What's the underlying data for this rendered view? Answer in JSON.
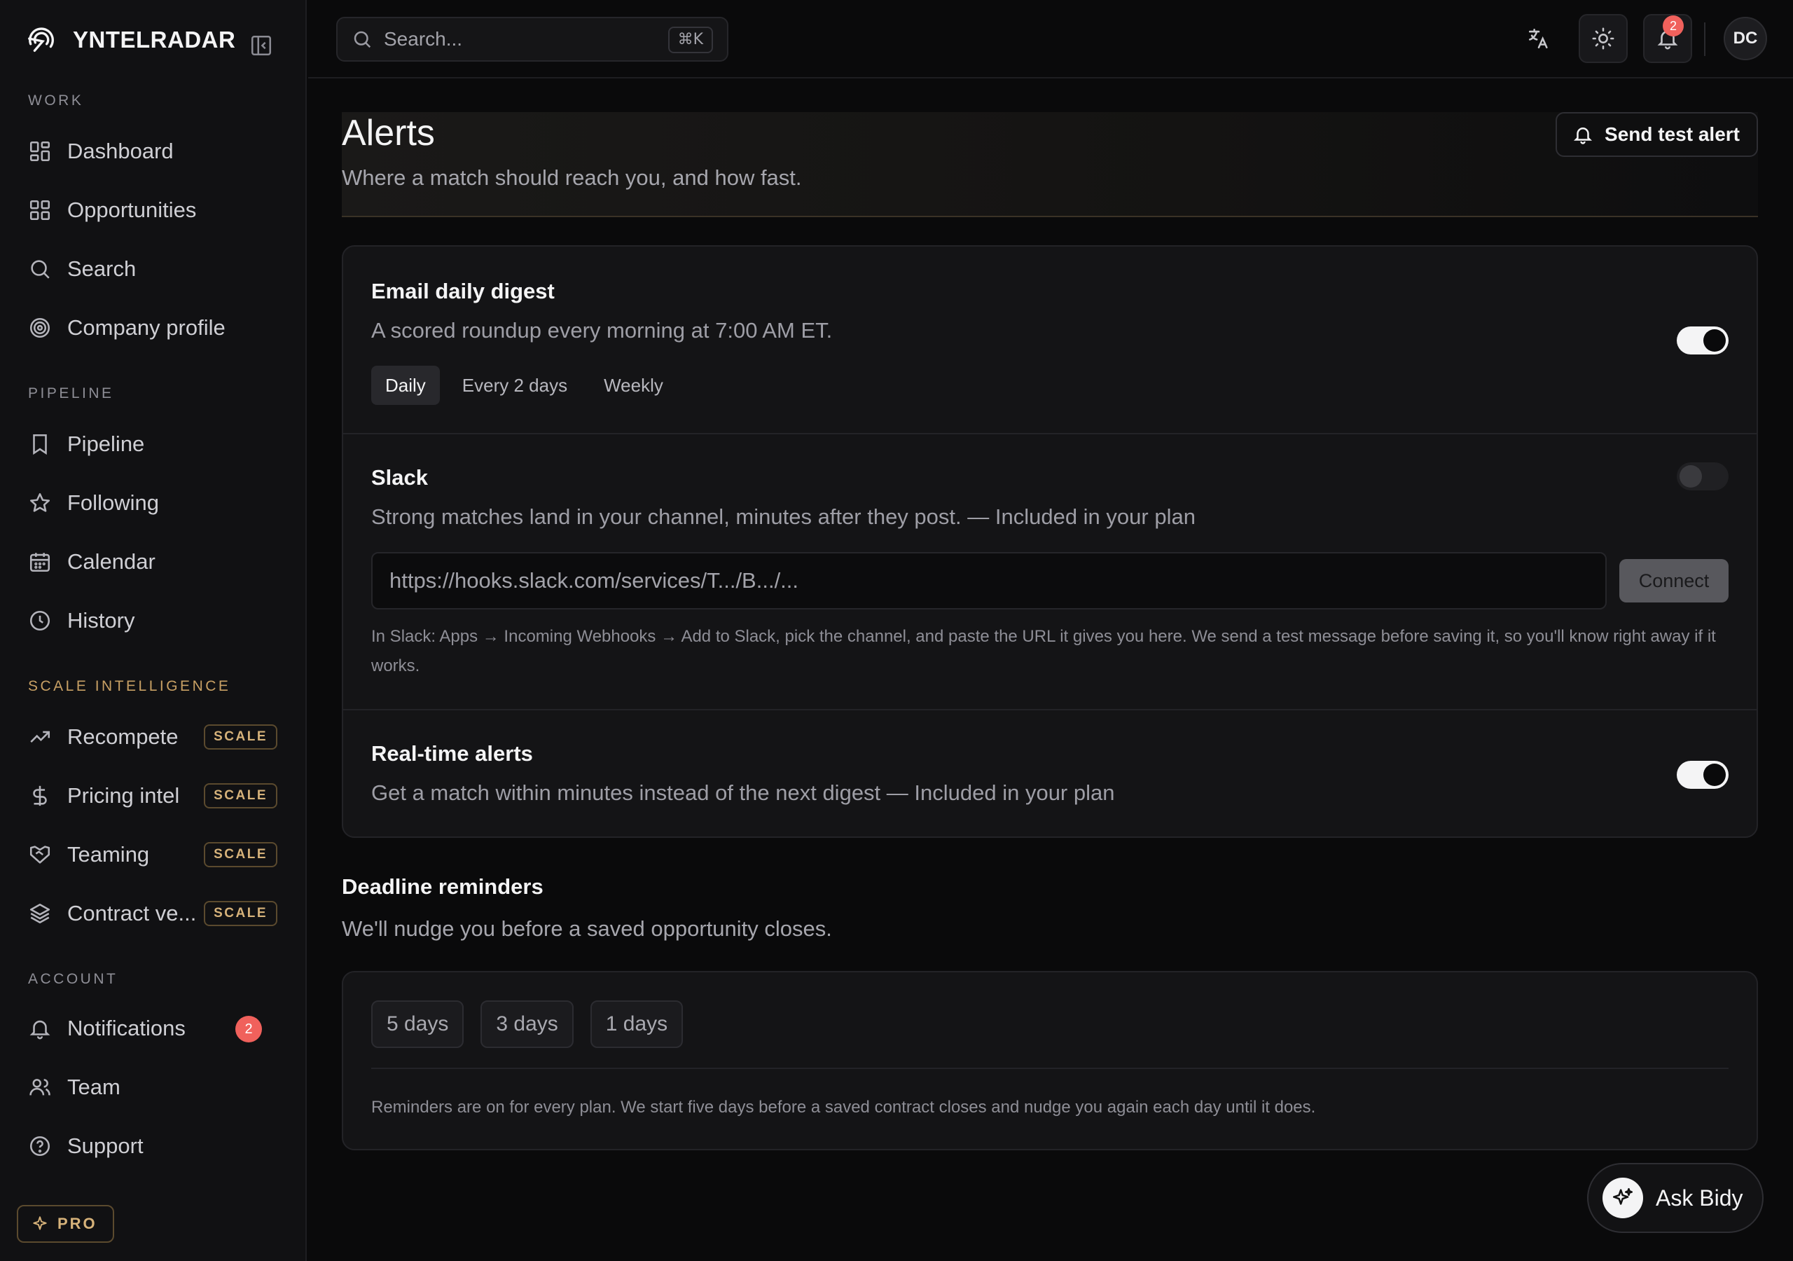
{
  "brand": {
    "name": "YNTELRADAR"
  },
  "sidebar": {
    "sections": [
      {
        "label": "WORK",
        "items": [
          {
            "label": "Dashboard",
            "icon": "dashboard-grid-icon"
          },
          {
            "label": "Opportunities",
            "icon": "grid-icon"
          },
          {
            "label": "Search",
            "icon": "search-icon"
          },
          {
            "label": "Company profile",
            "icon": "target-icon"
          }
        ]
      },
      {
        "label": "PIPELINE",
        "items": [
          {
            "label": "Pipeline",
            "icon": "bookmark-icon"
          },
          {
            "label": "Following",
            "icon": "star-icon"
          },
          {
            "label": "Calendar",
            "icon": "calendar-icon"
          },
          {
            "label": "History",
            "icon": "clock-icon"
          }
        ]
      },
      {
        "label": "SCALE INTELLIGENCE",
        "items": [
          {
            "label": "Recompete",
            "icon": "trending-up-icon",
            "badge": "SCALE"
          },
          {
            "label": "Pricing intel",
            "icon": "dollar-icon",
            "badge": "SCALE"
          },
          {
            "label": "Teaming",
            "icon": "handshake-icon",
            "badge": "SCALE"
          },
          {
            "label": "Contract ve...",
            "icon": "layers-icon",
            "badge": "SCALE"
          }
        ]
      },
      {
        "label": "ACCOUNT",
        "items": [
          {
            "label": "Notifications",
            "icon": "bell-icon",
            "count": "2"
          },
          {
            "label": "Team",
            "icon": "users-icon"
          },
          {
            "label": "Support",
            "icon": "help-circle-icon"
          }
        ]
      }
    ],
    "plan_badge": "PRO"
  },
  "topbar": {
    "search_placeholder": "Search...",
    "shortcut": "⌘K",
    "notification_count": "2",
    "avatar_initials": "DC"
  },
  "page": {
    "title": "Alerts",
    "subtitle": "Where a match should reach you, and how fast.",
    "test_button": "Send test alert"
  },
  "email_digest": {
    "title": "Email daily digest",
    "description": "A scored roundup every morning at 7:00 AM ET.",
    "enabled": true,
    "frequency_options": [
      "Daily",
      "Every 2 days",
      "Weekly"
    ],
    "selected": "Daily"
  },
  "slack": {
    "title": "Slack",
    "description": "Strong matches land in your channel, minutes after they post. — Included in your plan",
    "enabled": false,
    "webhook_placeholder": "https://hooks.slack.com/services/T.../B.../...",
    "connect_label": "Connect",
    "help": "In Slack: Apps → Incoming Webhooks → Add to Slack, pick the channel, and paste the URL it gives you here. We send a test message before saving it, so you'll know right away if it works."
  },
  "realtime": {
    "title": "Real-time alerts",
    "description": "Get a match within minutes instead of the next digest — Included in your plan",
    "enabled": true
  },
  "deadline": {
    "title": "Deadline reminders",
    "subtitle": "We'll nudge you before a saved opportunity closes.",
    "options": [
      "5 days",
      "3 days",
      "1 days"
    ],
    "note": "Reminders are on for every plan. We start five days before a saved contract closes and nudge you again each day until it does."
  },
  "assistant": {
    "label": "Ask Bidy"
  },
  "colors": {
    "accent_gold": "#c8a064",
    "badge_red": "#f0615c",
    "background": "#0a0a0b"
  }
}
